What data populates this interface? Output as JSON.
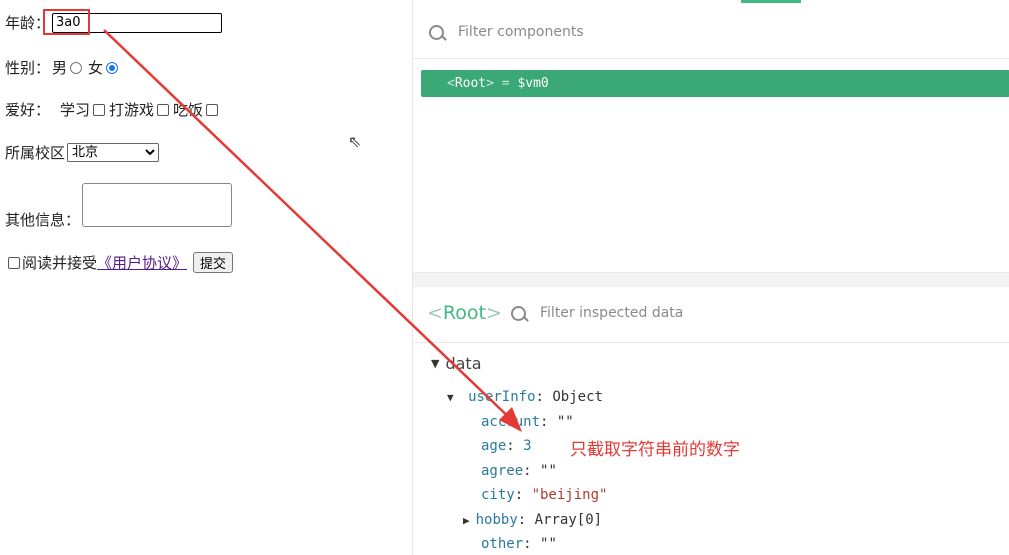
{
  "form": {
    "age_label": "年龄：",
    "age_value": "3a0",
    "gender_label": "性别：",
    "gender_male": "男",
    "gender_female": "女",
    "hobby_label": "爱好：",
    "hobby_study": "学习",
    "hobby_game": "打游戏",
    "hobby_eat": "吃饭",
    "campus_label": "所属校区",
    "campus_selected": "北京",
    "other_label": "其他信息：",
    "agree_text": "阅读并接受",
    "agree_link": "《用户协议》",
    "submit_label": "提交"
  },
  "devtools": {
    "filter_components_placeholder": "Filter components",
    "root_row": {
      "open": "<",
      "name": "Root",
      "close": ">",
      "eq": " = ",
      "vm": "$vm0"
    },
    "inspect_root_open": "<",
    "inspect_root_name": "Root",
    "inspect_root_close": ">",
    "filter_inspected_placeholder": "Filter inspected data",
    "section": "data",
    "object_key": "userInfo",
    "object_type": ": Object",
    "props": [
      {
        "key": "account",
        "value": "\"\""
      },
      {
        "key": "age",
        "value": "3"
      },
      {
        "key": "agree",
        "value": "\"\""
      },
      {
        "key": "city",
        "value": "\"beijing\""
      },
      {
        "key": "hobby",
        "value": "Array[0]"
      },
      {
        "key": "other",
        "value": "\"\""
      }
    ]
  },
  "annotation": {
    "note": "只截取字符串前的数字",
    "color": "#e53935"
  }
}
